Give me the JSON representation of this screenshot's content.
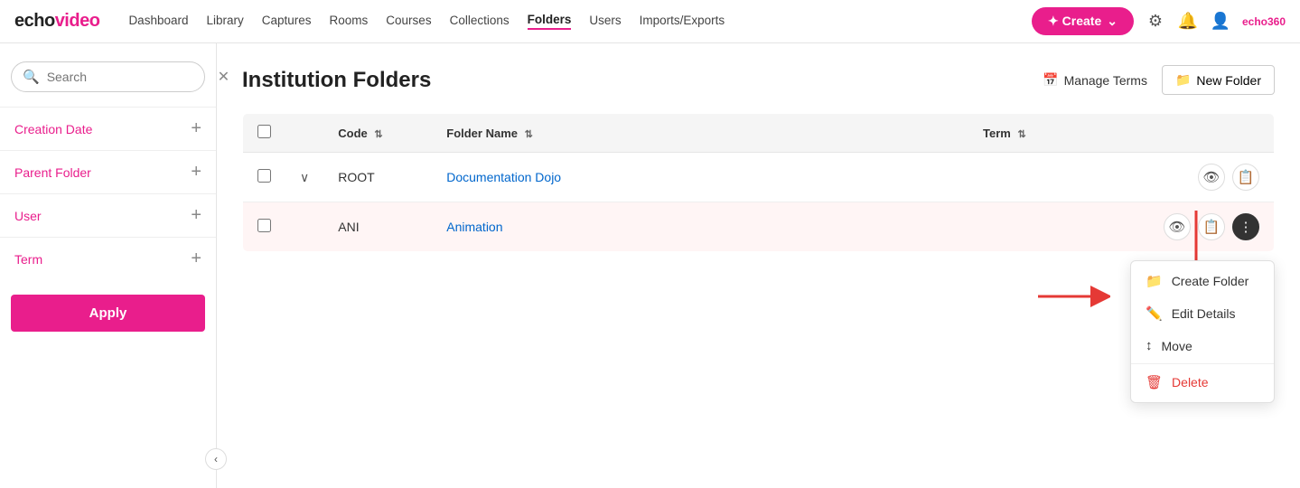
{
  "logo": {
    "echo": "echo",
    "video": "video"
  },
  "nav": {
    "links": [
      {
        "label": "Dashboard",
        "active": false
      },
      {
        "label": "Library",
        "active": false
      },
      {
        "label": "Captures",
        "active": false
      },
      {
        "label": "Rooms",
        "active": false
      },
      {
        "label": "Courses",
        "active": false
      },
      {
        "label": "Collections",
        "active": false
      },
      {
        "label": "Folders",
        "active": true
      },
      {
        "label": "Users",
        "active": false
      },
      {
        "label": "Imports/Exports",
        "active": false
      }
    ],
    "create_label": "✦ Create",
    "create_chevron": "⌄",
    "user_label": "echo360",
    "settings_icon": "⚙",
    "bell_icon": "🔔",
    "user_icon": "👤"
  },
  "sidebar": {
    "search_placeholder": "Search",
    "filters": [
      {
        "label": "Creation Date",
        "id": "creation-date"
      },
      {
        "label": "Parent Folder",
        "id": "parent-folder"
      },
      {
        "label": "User",
        "id": "user"
      },
      {
        "label": "Term",
        "id": "term"
      }
    ],
    "apply_label": "Apply",
    "collapse_icon": "‹"
  },
  "main": {
    "title": "Institution Folders",
    "manage_terms_label": "Manage Terms",
    "new_folder_label": "New Folder",
    "table": {
      "columns": [
        {
          "label": "Code",
          "sortable": true
        },
        {
          "label": "Folder Name",
          "sortable": true
        },
        {
          "label": "Term",
          "sortable": true
        }
      ],
      "rows": [
        {
          "id": 1,
          "code": "ROOT",
          "name": "Documentation Dojo",
          "term": "",
          "expanded": true,
          "highlighted": false
        },
        {
          "id": 2,
          "code": "ANI",
          "name": "Animation",
          "term": "",
          "expanded": false,
          "highlighted": true
        }
      ]
    }
  },
  "context_menu": {
    "items": [
      {
        "label": "Create Folder",
        "icon": "📁",
        "type": "pink",
        "id": "create-folder"
      },
      {
        "label": "Edit Details",
        "icon": "✏️",
        "type": "normal",
        "id": "edit-details"
      },
      {
        "label": "Move",
        "icon": "↕",
        "type": "normal",
        "id": "move"
      },
      {
        "label": "Delete",
        "icon": "🗑",
        "type": "danger",
        "id": "delete"
      }
    ]
  }
}
